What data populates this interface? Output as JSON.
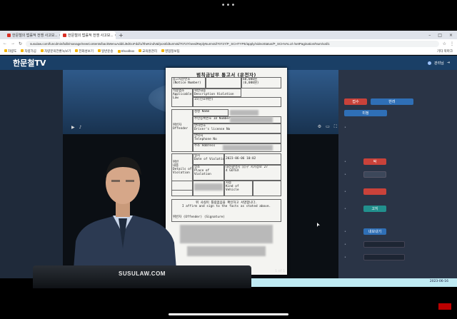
{
  "browser": {
    "tabs": [
      {
        "label": "한문철의 법률적 전쟁 사고보..."
      },
      {
        "label": "한문철의 법률적 전쟁 사고보..."
      }
    ],
    "url": "susulaw.com/funcdmin/bdb/manage/newContents/backMenuAdd/Li9dGoFdd/1//theKindVal/post/idtumVal/70727/needReplyNumVal/70727/P_SCHTYPE/apply/videoStatus/P_SCHVALU/-/setPagination/Num/val/1",
    "bookmarks": [
      "차량도",
      "차량가공",
      "차량문의전환녹보기",
      "전화성보기",
      "일반운송",
      "Shoolbox",
      "교육원관리",
      "영업정보팀"
    ],
    "bookmark_right": "기타 북마크"
  },
  "site": {
    "logo": "한문철TV",
    "user": "관리님"
  },
  "document": {
    "title": "범칙금납부 통고서 (운전자)",
    "cells": {
      "notice_no": "통고처분번호\n(Notice Number)",
      "applicable_law": "적용법조\nApplicable\nLaw",
      "description": "위반내용\nDescription Violation",
      "amount": "60,000원\n(6,000원)",
      "code": "15(신호위반)",
      "name": "성명 Name",
      "id_no": "주민등록번호 ID Number",
      "offender": "위반자\nOffender",
      "license": "면허번호\nDriver's license No",
      "phone": "연락처\nTelephone No",
      "address": "주소 Address",
      "date_of_violation": "일시\nDate of Violation",
      "date_value": "2023-06-06 10:02",
      "details": "위반\n내용\nDetails of\nViolation",
      "place": "장소\nPlace of\nViolation",
      "place_value": "대전광역시 ○○구 시가장로 27\n4 GOTEX",
      "vehicle_no": "차량번호\nNo. of\nVehicle",
      "vehicle_kind": "차종\nKind of\nVehicle",
      "confirm": "위 사실이 틀림없음을 확인하고 서명합니다.\nI affirm and sign to the facts as stated above.",
      "signature": "위반자 (Offender)            (Signature)"
    },
    "pager": "1 of 1"
  },
  "right_panel": {
    "buttons": [
      "접수",
      "반려",
      "미정",
      "팍",
      "고지",
      "내보내기"
    ]
  },
  "footer": {
    "date": "2023-06-16"
  },
  "desk_label": "SUSULAW.COM"
}
